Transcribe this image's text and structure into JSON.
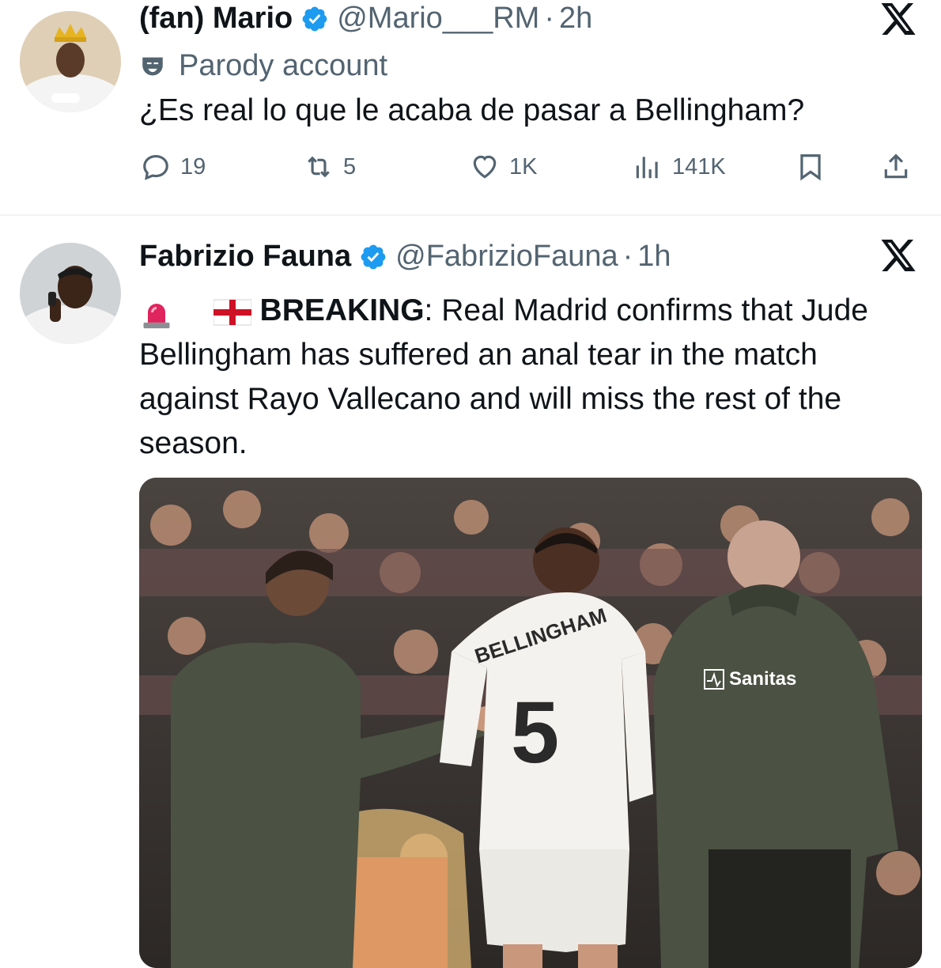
{
  "tweet1": {
    "name": "(fan) Mario",
    "handle": "@Mario___RM",
    "separator": "·",
    "time": "2h",
    "parody_label": "Parody account",
    "text": "¿Es real lo que le acaba de pasar a Bellingham?",
    "stats": {
      "replies": "19",
      "reposts": "5",
      "likes": "1K",
      "views": "141K"
    },
    "icons": [
      "verified-badge-icon",
      "x-logo-icon",
      "parody-mask-icon",
      "reply-icon",
      "repost-icon",
      "like-icon",
      "views-icon",
      "bookmark-icon",
      "share-icon"
    ]
  },
  "tweet2": {
    "name": "Fabrizio Fauna",
    "handle": "@FabrizioFauna",
    "separator": "·",
    "time": "1h",
    "body": {
      "emoji_siren": "🚨",
      "emoji_flag": "🏴",
      "breaking": "BREAKING",
      "colon": ":",
      "text": "Real Madrid confirms that Jude Bellingham has suffered an anal tear in the match against Rayo Vallecano and will miss the rest of the season."
    },
    "media": {
      "jersey_name": "BELLINGHAM",
      "jersey_number": "5",
      "jacket_brand": "Sanitas"
    },
    "icons": [
      "verified-badge-icon",
      "x-logo-icon",
      "siren-icon",
      "england-flag-icon"
    ]
  },
  "colors": {
    "text": "#0f1419",
    "secondary": "#536471",
    "verified": "#1d9bf0",
    "divider": "#eff3f4",
    "siren": "#e0245e"
  }
}
